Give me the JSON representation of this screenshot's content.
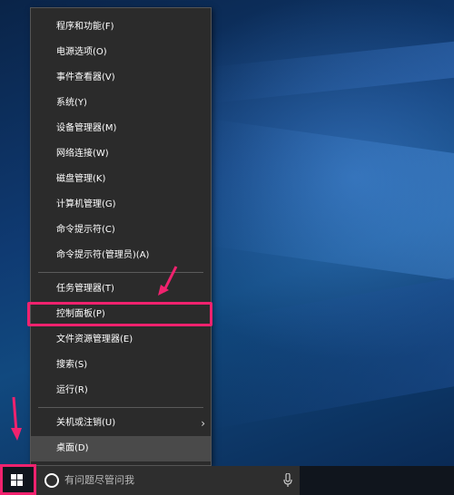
{
  "context_menu": {
    "items": [
      {
        "label": "程序和功能(F)"
      },
      {
        "label": "电源选项(O)"
      },
      {
        "label": "事件查看器(V)"
      },
      {
        "label": "系统(Y)"
      },
      {
        "label": "设备管理器(M)"
      },
      {
        "label": "网络连接(W)"
      },
      {
        "label": "磁盘管理(K)"
      },
      {
        "label": "计算机管理(G)"
      },
      {
        "label": "命令提示符(C)"
      },
      {
        "label": "命令提示符(管理员)(A)"
      },
      {
        "label": "任务管理器(T)"
      },
      {
        "label": "控制面板(P)"
      },
      {
        "label": "文件资源管理器(E)"
      },
      {
        "label": "搜索(S)"
      },
      {
        "label": "运行(R)"
      },
      {
        "label": "关机或注销(U)"
      },
      {
        "label": "桌面(D)"
      }
    ],
    "submenu_glyph": "›"
  },
  "taskbar": {
    "search_placeholder": "有问题尽管问我"
  },
  "colors": {
    "highlight": "#f0226e",
    "menu_bg": "#2b2b2b",
    "taskbar_bg": "#10151d"
  }
}
